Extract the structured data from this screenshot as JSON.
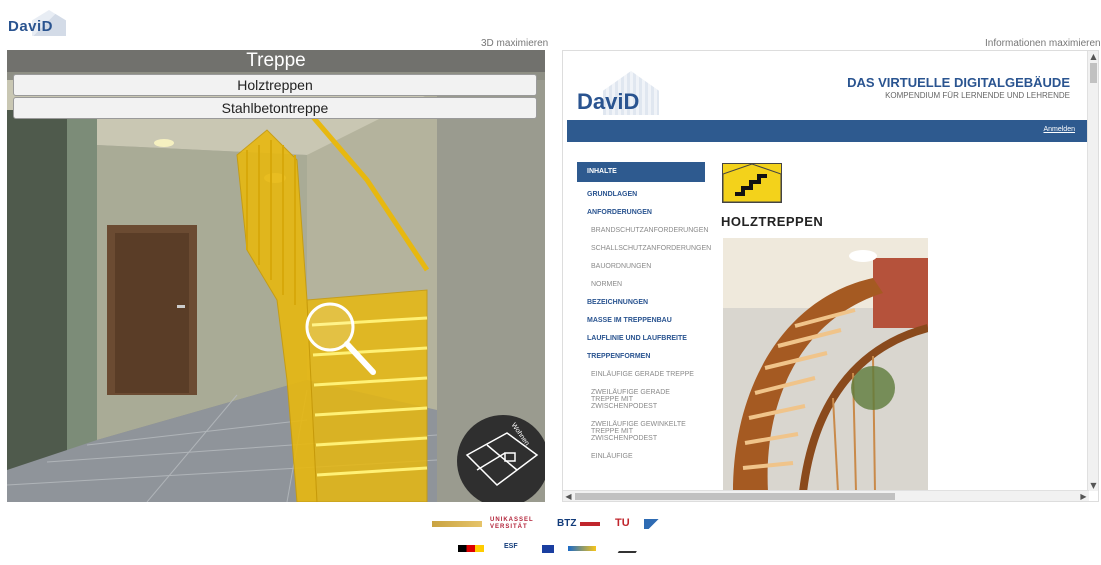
{
  "app": {
    "logo_text": "DaviD"
  },
  "view3d": {
    "maximize_label": "3D maximieren",
    "title": "Treppe",
    "options": [
      "Holztreppen",
      "Stahlbetontreppe"
    ],
    "minimap_label": "Wohnen"
  },
  "info": {
    "maximize_label": "Informationen maximieren",
    "site_logo": "DaviD",
    "site_title": "DAS VIRTUELLE DIGITALGEBÄUDE",
    "site_subtitle": "KOMPENDIUM FÜR LERNENDE UND LEHRENDE",
    "login_label": "Anmelden",
    "nav_header": "INHALTE",
    "nav": [
      {
        "label": "GRUNDLAGEN",
        "level": "main"
      },
      {
        "label": "ANFORDERUNGEN",
        "level": "main"
      },
      {
        "label": "BRANDSCHUTZANFORDERUNGEN",
        "level": "sub"
      },
      {
        "label": "SCHALLSCHUTZANFORDERUNGEN",
        "level": "sub"
      },
      {
        "label": "BAUORDNUNGEN",
        "level": "sub"
      },
      {
        "label": "NORMEN",
        "level": "sub"
      },
      {
        "label": "BEZEICHNUNGEN",
        "level": "main"
      },
      {
        "label": "MASSE IM TREPPENBAU",
        "level": "main"
      },
      {
        "label": "LAUFLINIE UND LAUFBREITE",
        "level": "main"
      },
      {
        "label": "TREPPENFORMEN",
        "level": "main"
      },
      {
        "label": "EINLÄUFIGE GERADE TREPPE",
        "level": "sub"
      },
      {
        "label": "ZWEILÄUFIGE GERADE TREPPE MIT ZWISCHENPODEST",
        "level": "sub"
      },
      {
        "label": "ZWEILÄUFIGE GEWINKELTE TREPPE MIT ZWISCHENPODEST",
        "level": "sub"
      },
      {
        "label": "EINLÄUFIGE",
        "level": "sub"
      }
    ],
    "page_heading": "HOLZTREPPEN"
  },
  "footer": {
    "row1": [
      "UNIKASSEL VERSITÄT",
      "BTZ",
      "TU"
    ],
    "row2": [
      "ESF"
    ]
  },
  "colors": {
    "brand_blue": "#2e5a8f",
    "stair_yellow": "#f3c51a"
  }
}
